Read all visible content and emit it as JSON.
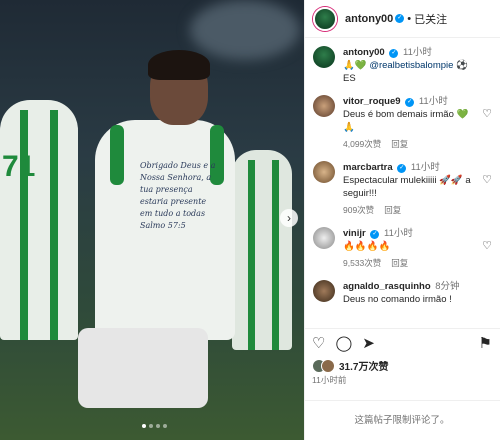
{
  "header": {
    "username": "antony00",
    "separator": "•",
    "follow_status": "已关注"
  },
  "caption": {
    "username": "antony00",
    "time": "11小时",
    "emojis": "🙏💚",
    "mention": "@realbetisbalompie",
    "trailing": "⚽ES"
  },
  "comments": [
    {
      "username": "vitor_roque9",
      "verified": true,
      "time": "11小时",
      "text": "Deus é bom demais irmão 💚🙏",
      "likes": "4,099次赞",
      "reply": "回复",
      "has_heart": true
    },
    {
      "username": "marcbartra",
      "verified": true,
      "time": "11小时",
      "text": "Espectacular mulekiiiii 🚀🚀 a seguir!!!",
      "likes": "909次赞",
      "reply": "回复",
      "has_heart": true
    },
    {
      "username": "vinijr",
      "verified": true,
      "time": "11小时",
      "text": "🔥🔥🔥🔥",
      "likes": "9,533次赞",
      "reply": "回复",
      "has_heart": true
    },
    {
      "username": "agnaldo_rasquinho",
      "verified": false,
      "time": "8分钟",
      "text": "Deus no comando irmão !",
      "likes": "",
      "reply": "",
      "has_heart": false
    }
  ],
  "actions": {
    "like_icon": "heart-icon",
    "comment_icon": "comment-icon",
    "share_icon": "send-icon",
    "save_icon": "bookmark-icon"
  },
  "likes_summary": "31.7万次赞",
  "post_time": "11小时前",
  "comments_disabled": "这篇帖子限制评论了。",
  "photo": {
    "shirt_text": "Obrigado Deus e a Nossa Senhora, a tua presença estaria presente em tudo a todas Salmo 57:5",
    "player_number": "71"
  },
  "colors": {
    "accent_blue": "#0095f6",
    "betis_green": "#1f8a3c"
  }
}
